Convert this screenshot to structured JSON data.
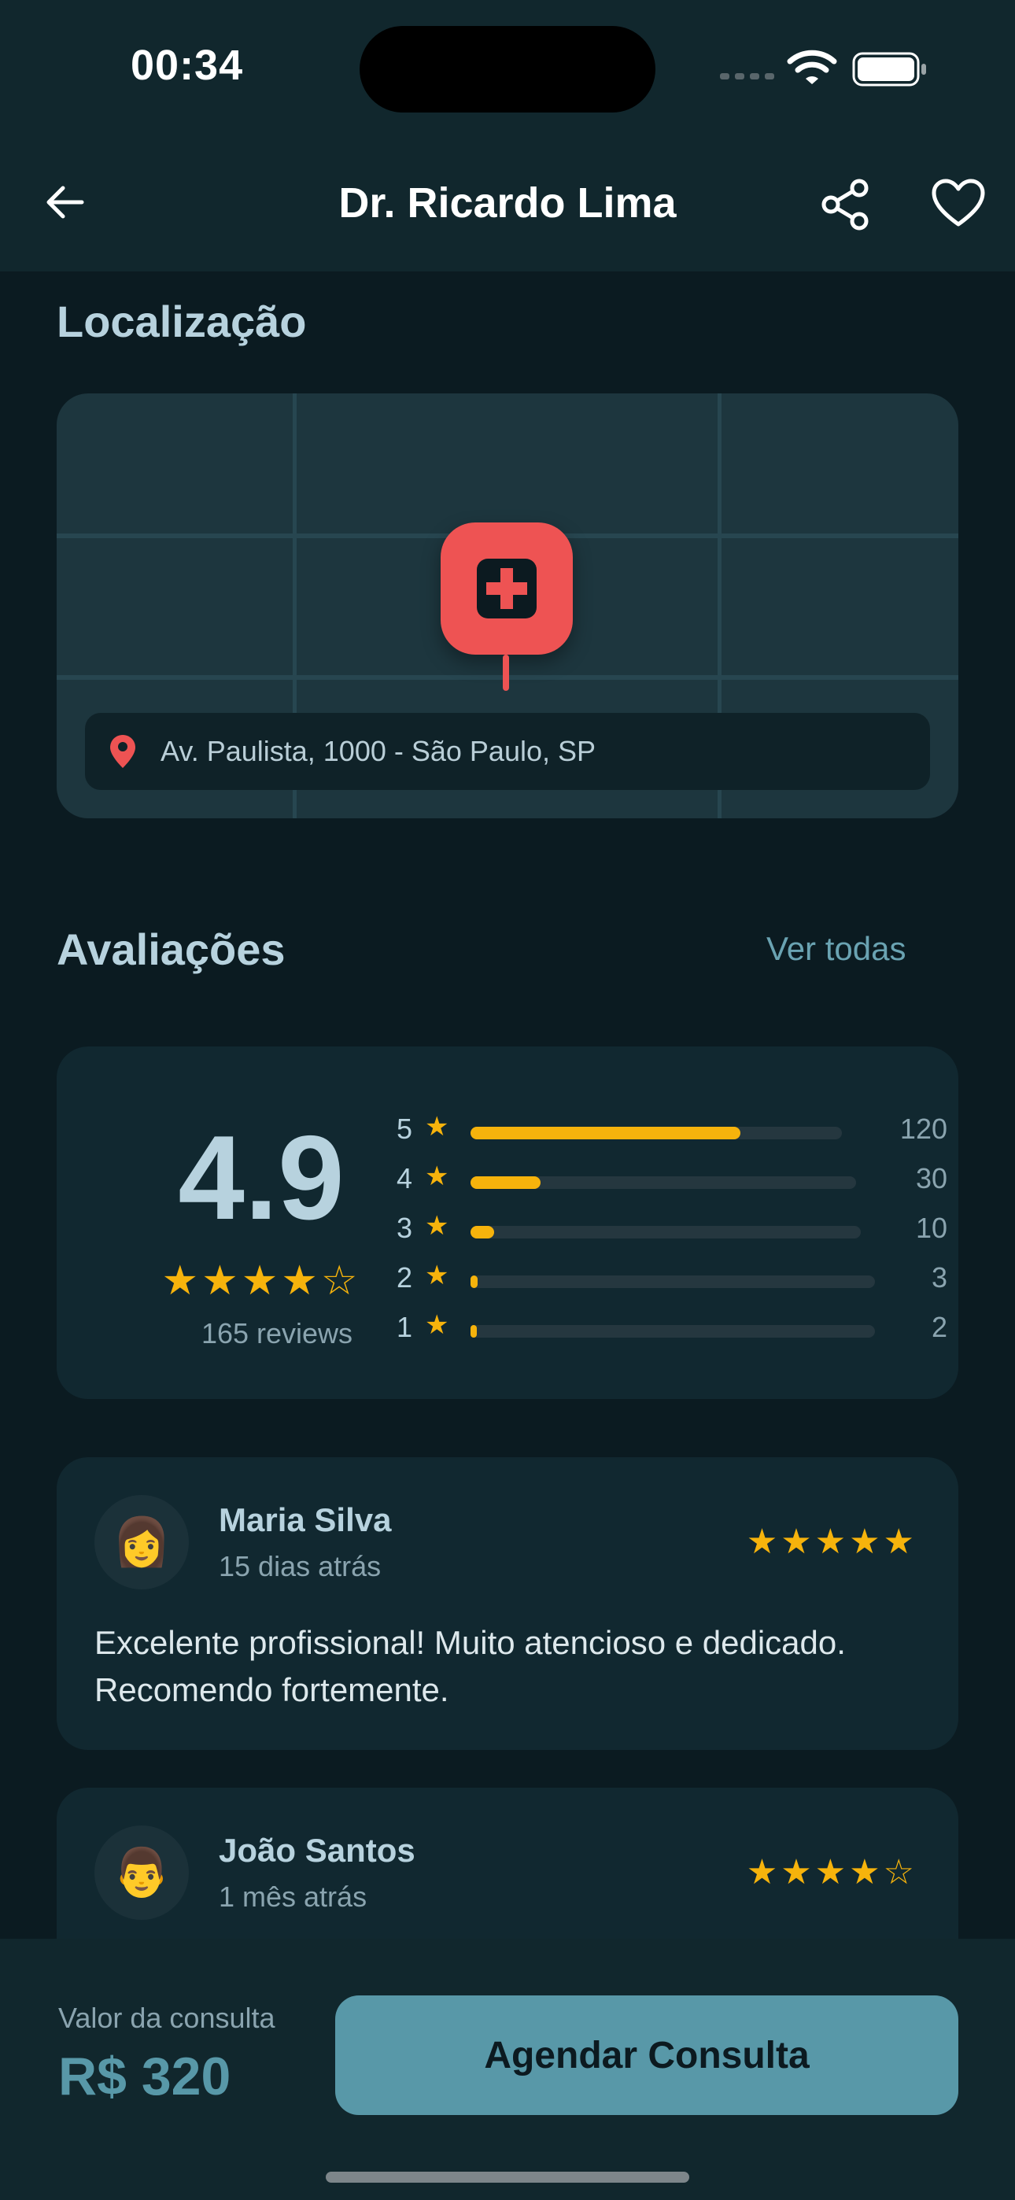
{
  "status_bar": {
    "time": "00:34"
  },
  "header": {
    "title": "Dr. Ricardo Lima"
  },
  "location": {
    "section_title": "Localização",
    "address": "Av. Paulista, 1000 - São Paulo, SP"
  },
  "reviews_section": {
    "title": "Avaliações",
    "see_all": "Ver todas",
    "rating": "4.9",
    "stars": "★★★★☆",
    "count_label": "165 reviews",
    "distribution": [
      {
        "stars": "5",
        "count": "120",
        "fraction": 0.727
      },
      {
        "stars": "4",
        "count": "30",
        "fraction": 0.182
      },
      {
        "stars": "3",
        "count": "10",
        "fraction": 0.061
      },
      {
        "stars": "2",
        "count": "3",
        "fraction": 0.018
      },
      {
        "stars": "1",
        "count": "2",
        "fraction": 0.012
      }
    ]
  },
  "reviews": [
    {
      "name": "Maria Silva",
      "time": "15 dias atrás",
      "stars": "★★★★★",
      "avatar": "👩",
      "text": "Excelente profissional! Muito atencioso e dedicado. Recomendo fortemente."
    },
    {
      "name": "João Santos",
      "time": "1 mês atrás",
      "stars": "★★★★☆",
      "avatar": "👨",
      "text": ""
    }
  ],
  "footer": {
    "price_label": "Valor da consulta",
    "price": "R$ 320",
    "cta_label": "Agendar Consulta"
  },
  "colors": {
    "background": "#0b1b21",
    "card": "#112830",
    "accent": "#5898a8",
    "star": "#f6b30c",
    "pin": "#ee5353"
  }
}
